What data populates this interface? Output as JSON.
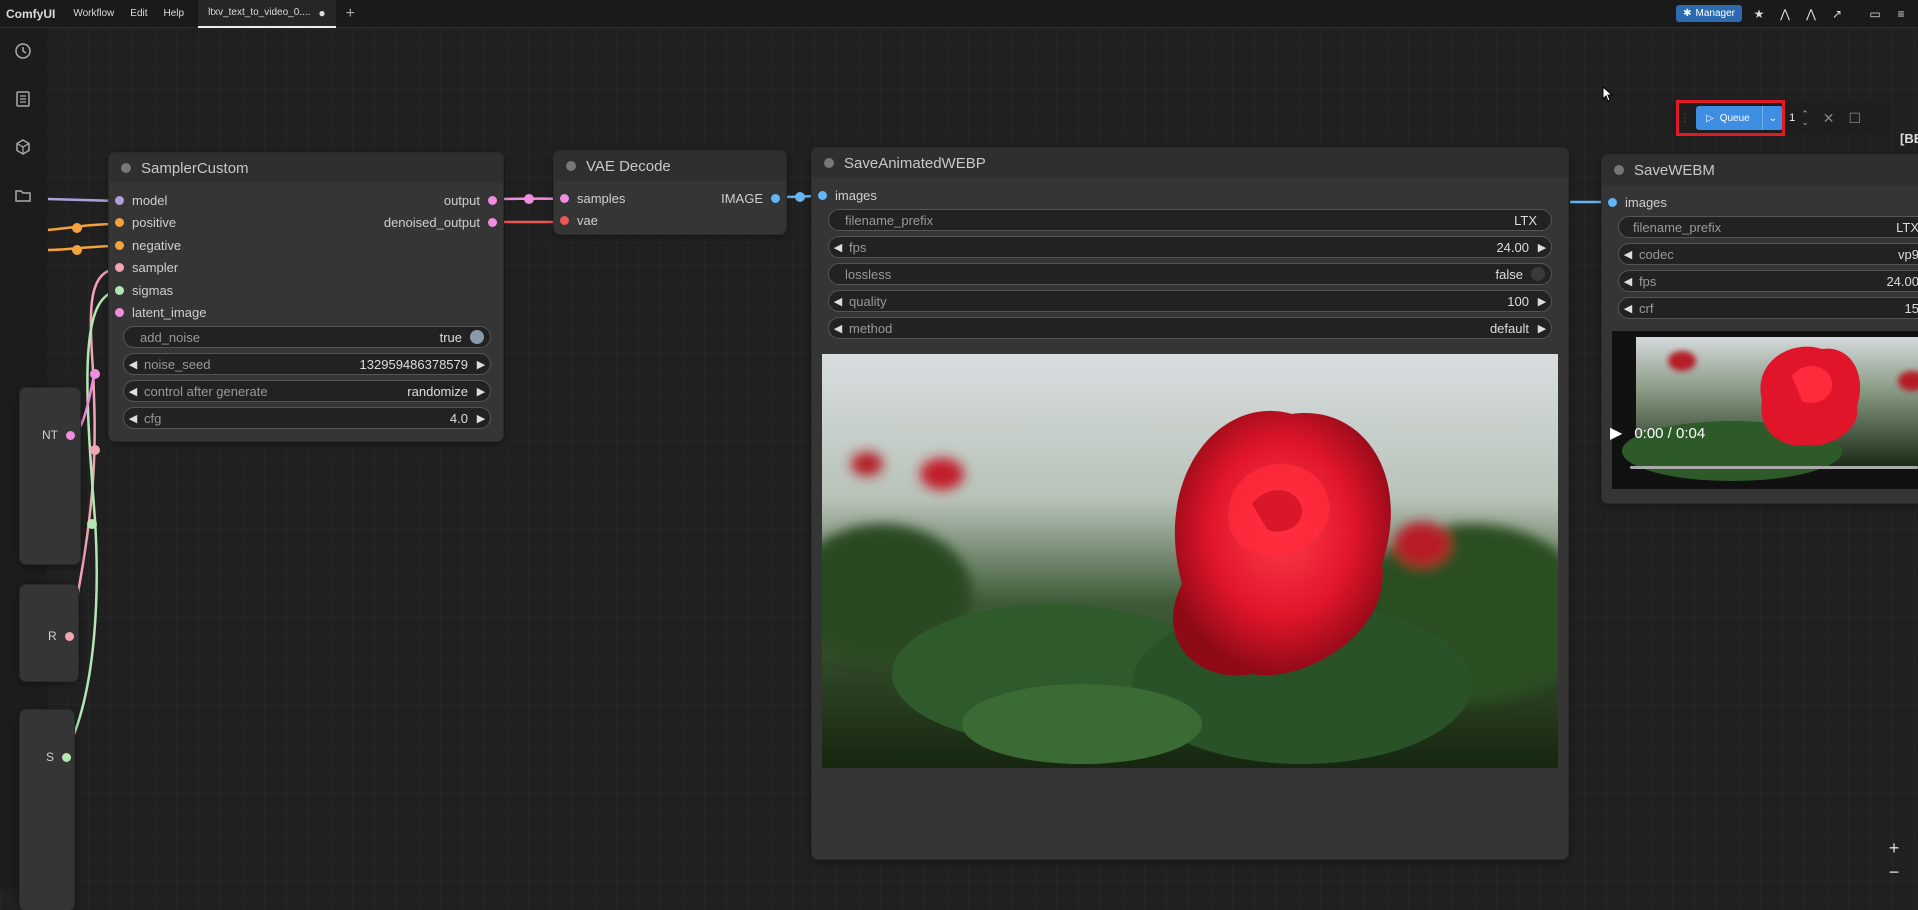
{
  "app": {
    "name": "ComfyUI"
  },
  "menu": [
    {
      "label": "Workflow"
    },
    {
      "label": "Edit"
    },
    {
      "label": "Help"
    }
  ],
  "tab": {
    "label": "ltxv_text_to_video_0....",
    "modified_marker": "●"
  },
  "toolbar": {
    "manager_label": "Manager"
  },
  "queue": {
    "label": "Queue",
    "count": "1"
  },
  "left_stub": {
    "label_a": "NT",
    "label_b": "R",
    "label_c": "S"
  },
  "nodes": {
    "sampler_custom": {
      "title": "SamplerCustom",
      "inputs": [
        {
          "label": "model",
          "color": "#b39ddb"
        },
        {
          "label": "positive",
          "color": "#f4a23c"
        },
        {
          "label": "negative",
          "color": "#f4a23c"
        },
        {
          "label": "sampler",
          "color": "#f2a4b4"
        },
        {
          "label": "sigmas",
          "color": "#b4e7b4"
        },
        {
          "label": "latent_image",
          "color": "#f08ddf"
        }
      ],
      "outputs": [
        {
          "label": "output",
          "color": "#f08ddf"
        },
        {
          "label": "denoised_output",
          "color": "#f08ddf"
        }
      ],
      "widgets": {
        "add_noise": {
          "label": "add_noise",
          "value": "true"
        },
        "noise_seed": {
          "label": "noise_seed",
          "value": "132959486378579"
        },
        "control": {
          "label": "control after generate",
          "value": "randomize"
        },
        "cfg": {
          "label": "cfg",
          "value": "4.0"
        }
      }
    },
    "vae_decode": {
      "title": "VAE Decode",
      "inputs": [
        {
          "label": "samples",
          "color": "#f08ddf"
        },
        {
          "label": "vae",
          "color": "#ee5555"
        }
      ],
      "output": {
        "label": "IMAGE",
        "color": "#64b5f6"
      }
    },
    "save_webp": {
      "title": "SaveAnimatedWEBP",
      "input": {
        "label": "images",
        "color": "#64b5f6"
      },
      "widgets": {
        "filename_prefix": {
          "label": "filename_prefix",
          "value": "LTX"
        },
        "fps": {
          "label": "fps",
          "value": "24.00"
        },
        "lossless": {
          "label": "lossless",
          "value": "false"
        },
        "quality": {
          "label": "quality",
          "value": "100"
        },
        "method": {
          "label": "method",
          "value": "default"
        }
      }
    },
    "save_webm": {
      "title": "SaveWEBM",
      "input": {
        "label": "images",
        "color": "#64b5f6"
      },
      "widgets": {
        "filename_prefix": {
          "label": "filename_prefix",
          "value": "LTX"
        },
        "codec": {
          "label": "codec",
          "value": "vp9"
        },
        "fps": {
          "label": "fps",
          "value": "24.00"
        },
        "crf": {
          "label": "crf",
          "value": "15"
        }
      },
      "video": {
        "time": "0:00 / 0:04"
      }
    }
  },
  "corner_text": "[BE"
}
